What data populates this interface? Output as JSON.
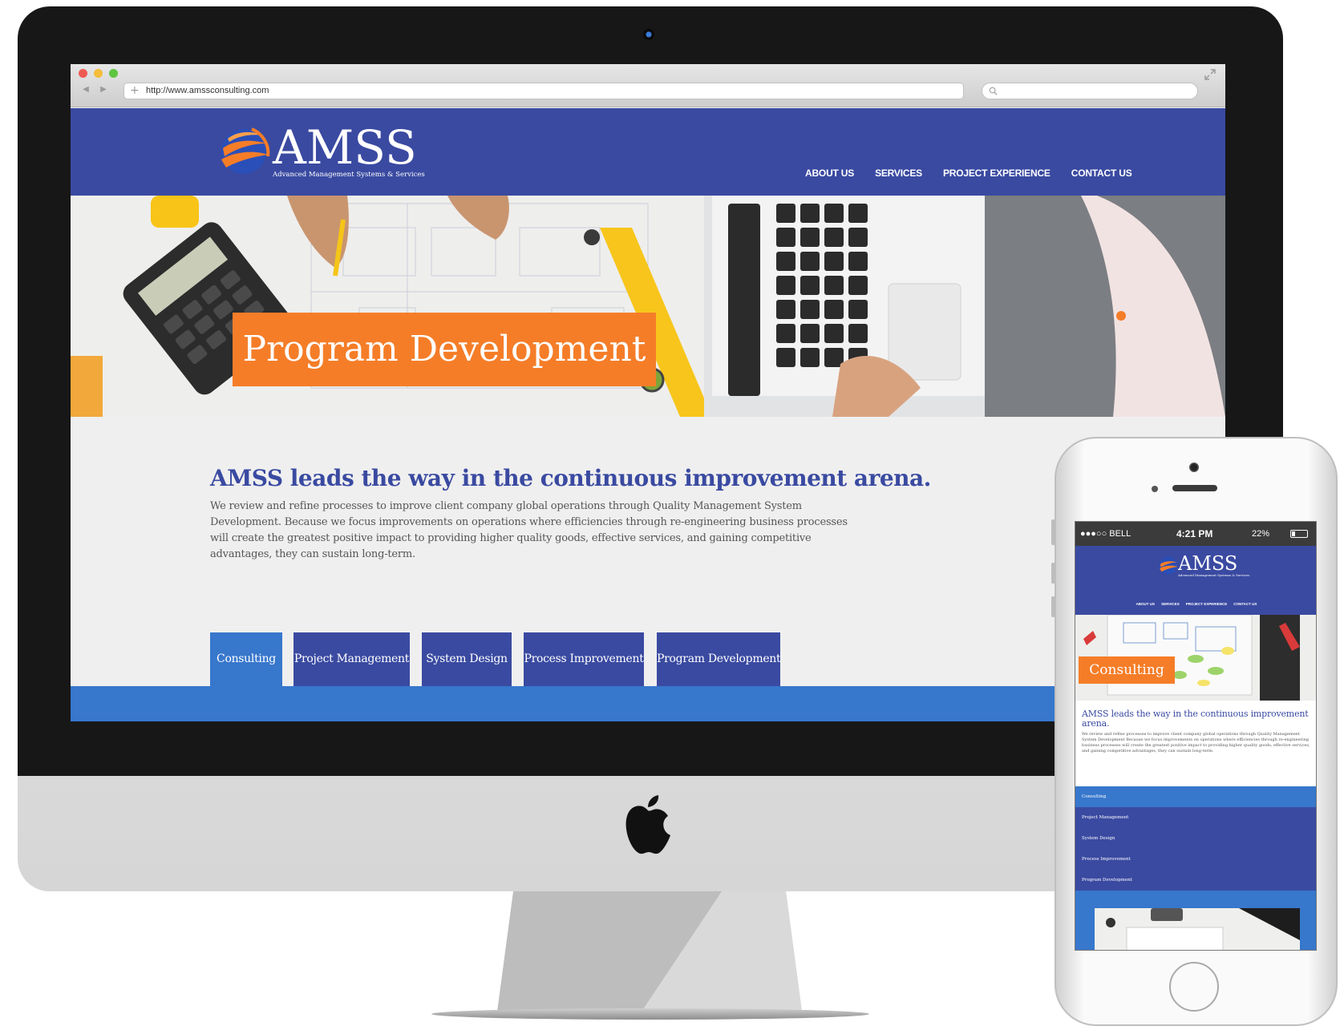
{
  "browser": {
    "url": "http://www.amssconsulting.com"
  },
  "site": {
    "logo_text": "AMSS",
    "logo_tagline": "Advanced Management Systems & Services",
    "nav": [
      "ABOUT US",
      "SERVICES",
      "PROJECT EXPERIENCE",
      "CONTACT US"
    ],
    "hero_title": "Program Development",
    "intro_heading": "AMSS leads the way in the continuous improvement arena.",
    "intro_body": "We review and refine processes to improve client company global operations through Quality Management System Development. Because we focus improvements on operations where efficiencies through re-engineering business processes will create the greatest positive impact to providing higher quality goods, effective services, and gaining competitive advantages, they can sustain long-term.",
    "tabs": [
      "Consulting",
      "Project Management",
      "System Design",
      "Process Improvement",
      "Program Development"
    ],
    "active_tab": "Consulting"
  },
  "mobile": {
    "carrier": "●●●○○ BELL",
    "time": "4:21 PM",
    "battery": "22%",
    "hero_title": "Consulting",
    "intro_heading": "AMSS leads the way in the continuous improvement arena.",
    "intro_body": "We review and refine processes to improve client company global operations through Quality Management System Development Because we focus improvements on operations where efficiencies through re-engineering business processes will create the greatest positive impact to providing higher quality goods, effective services, and gaining competitive advantages, they can sustain long-term.",
    "tabs": [
      "Consulting",
      "Project Management",
      "System Design",
      "Process Improvement",
      "Program Development"
    ]
  },
  "colors": {
    "brand_blue": "#3a4aa1",
    "accent_blue": "#3777cc",
    "accent_orange": "#f57d28"
  }
}
